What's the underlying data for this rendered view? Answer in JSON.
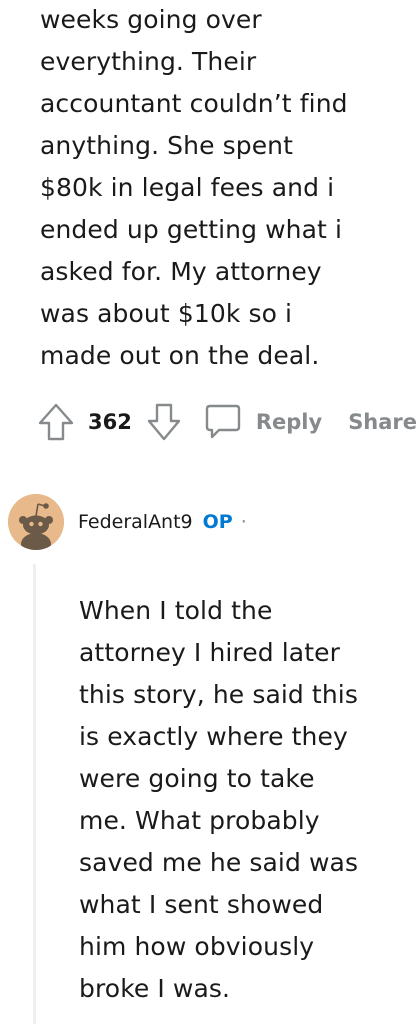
{
  "parent_comment": {
    "lines": [
      "weeks going over",
      "everything. Their",
      "accountant couldn’t find",
      "anything. She spent",
      "$80k in legal fees and i",
      "ended up getting what i",
      "asked for. My attorney",
      "was about $10k so i",
      "made out on the deal."
    ],
    "vote_count": "362",
    "reply_label": "Reply",
    "share_label": "Share"
  },
  "reply_comment": {
    "username": "FederalAnt9",
    "op_badge": "OP",
    "separator": "·",
    "lines": [
      "When I told the",
      "attorney I hired later",
      "this story, he said this",
      "is exactly where they",
      "were going to take",
      "me. What probably",
      "saved me he said was",
      "what I sent showed",
      "him how obviously",
      "broke I was."
    ]
  },
  "icons": {
    "upvote": "upvote-arrow-icon",
    "downvote": "downvote-arrow-icon",
    "reply": "comment-bubble-icon",
    "avatar": "snoo-avatar"
  },
  "colors": {
    "text": "#1a1a1b",
    "muted": "#878a8c",
    "op_blue": "#0079d3",
    "avatar_bg": "#e8b98a",
    "thread_line": "#edeff1"
  }
}
